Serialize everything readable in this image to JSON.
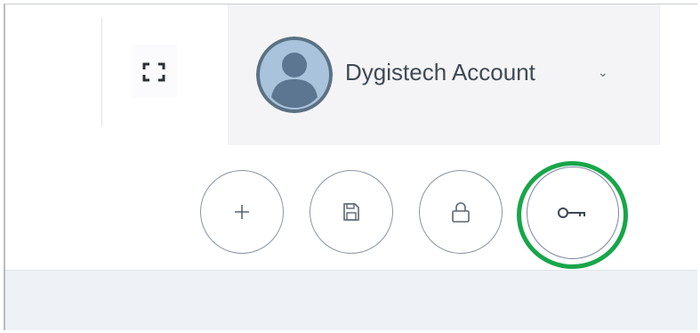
{
  "header": {
    "fullscreen_icon": "fullscreen-icon",
    "account": {
      "name": "Dygistech Account",
      "chevron": "⌄",
      "avatar_icon": "user-avatar-icon",
      "avatar_bg": "#5b7184",
      "avatar_fg": "#5c7591"
    }
  },
  "toolbar": {
    "buttons": [
      {
        "icon": "plus-icon",
        "label": "Add"
      },
      {
        "icon": "save-icon",
        "label": "Save"
      },
      {
        "icon": "lock-icon",
        "label": "Lock"
      },
      {
        "icon": "key-icon",
        "label": "Key",
        "highlighted": true
      }
    ],
    "highlight_color": "#18a64a"
  }
}
